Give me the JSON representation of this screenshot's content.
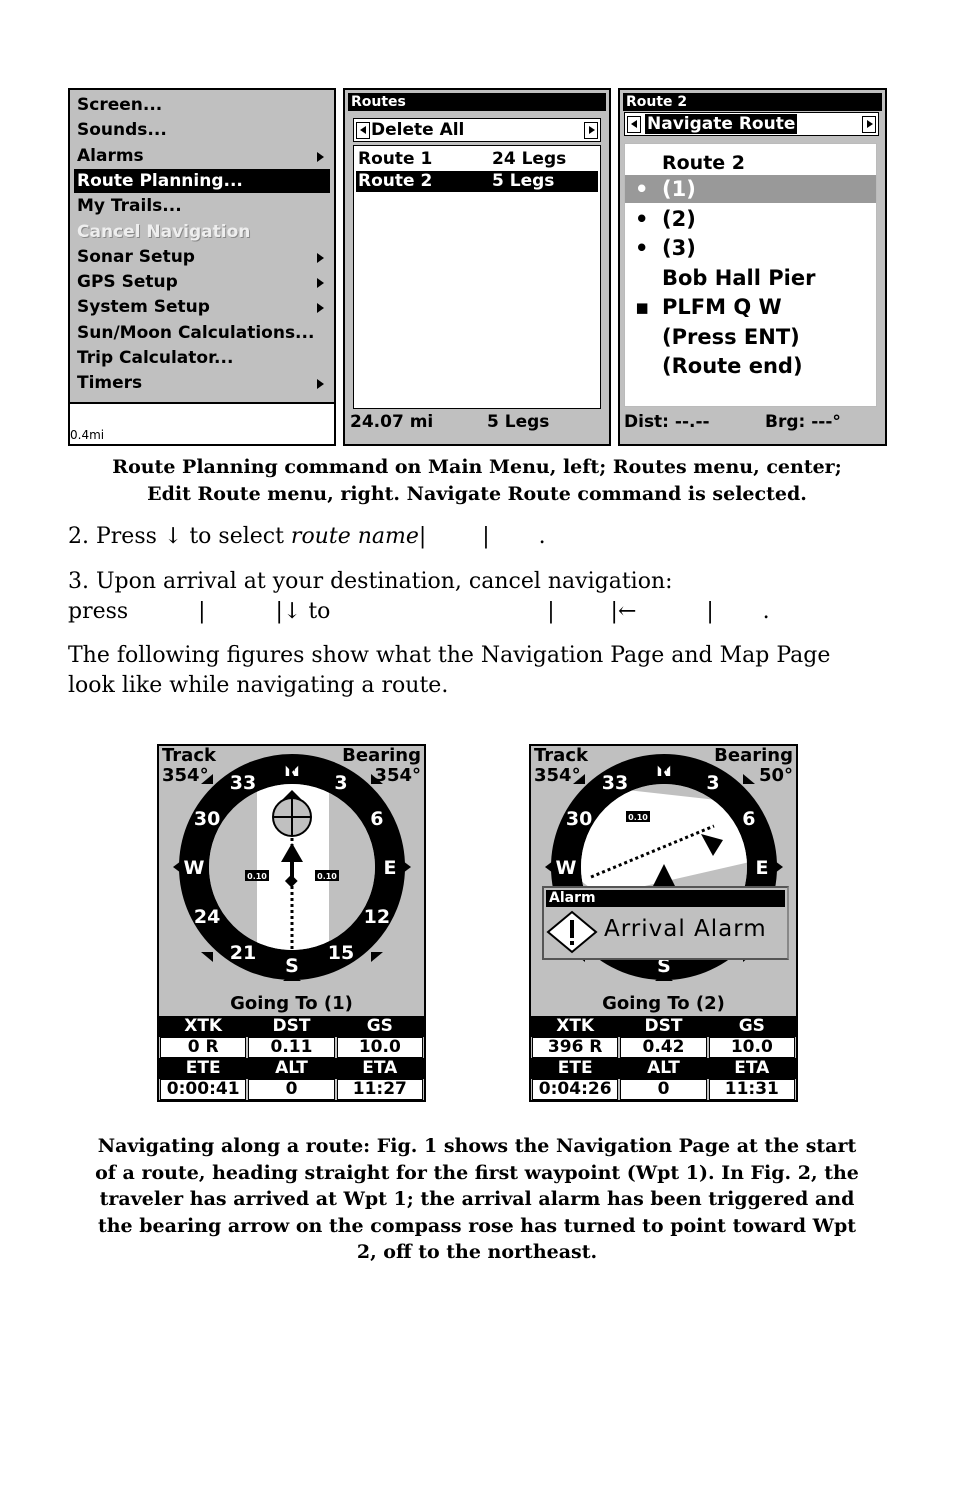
{
  "main_menu": {
    "items": [
      {
        "label": "Screen...",
        "submenu": false
      },
      {
        "label": "Sounds...",
        "submenu": false
      },
      {
        "label": "Alarms",
        "submenu": true
      },
      {
        "label": "Route Planning...",
        "submenu": false,
        "selected": true
      },
      {
        "label": "My Trails...",
        "submenu": false
      },
      {
        "label": "Cancel Navigation",
        "submenu": false,
        "disabled": true
      },
      {
        "label": "Sonar Setup",
        "submenu": true
      },
      {
        "label": "GPS Setup",
        "submenu": true
      },
      {
        "label": "System Setup",
        "submenu": true
      },
      {
        "label": "Sun/Moon Calculations...",
        "submenu": false
      },
      {
        "label": "Trip Calculator...",
        "submenu": false
      },
      {
        "label": "Timers",
        "submenu": true
      }
    ],
    "scale": "0.4mi"
  },
  "routes_menu": {
    "title": "Routes",
    "dropdown": "Delete All",
    "rows": [
      {
        "name": "Route 1",
        "legs": "24 Legs"
      },
      {
        "name": "Route 2",
        "legs": "5 Legs"
      }
    ],
    "status_dist": "24.07 mi",
    "status_legs": "5 Legs"
  },
  "edit_route": {
    "title": "Route 2",
    "dropdown": "Navigate Route",
    "heading": "Route 2",
    "items": [
      {
        "bullet": "•",
        "label": "(1)"
      },
      {
        "bullet": "•",
        "label": "(2)"
      },
      {
        "bullet": "•",
        "label": "(3)"
      },
      {
        "bullet": "",
        "label": "Bob Hall Pier"
      },
      {
        "bullet": "▪",
        "label": "PLFM Q W"
      },
      {
        "bullet": "",
        "label": "(Press ENT)"
      },
      {
        "bullet": "",
        "label": "(Route end)"
      }
    ],
    "dist": "Dist: --.--",
    "brg": "Brg: ---°"
  },
  "caption1_l1": "Route Planning command on Main Menu, left; Routes  menu, center;",
  "caption1_l2": "Edit Route menu, right. Navigate Route command is selected.",
  "step2": {
    "a": "2. Press ↓ to select ",
    "b": "route name",
    "c": "|        |       ."
  },
  "step3": {
    "l1": "3. Upon arrival at your destination, cancel navigation:",
    "l2": "press          |          |↓ to                               |        |←          |       ."
  },
  "para": {
    "l1": "The following figures show what the Navigation Page and Map Page",
    "l2": "look like while navigating a route."
  },
  "compass_labels": {
    "n": "N",
    "s": "S",
    "e": "E",
    "w": "W",
    "d3": "3",
    "d6": "6",
    "d12": "12",
    "d15": "15",
    "d21": "21",
    "d24": "24",
    "d30": "30",
    "d33": "33",
    "scale": "0.10"
  },
  "fig1": {
    "track_label": "Track",
    "track": "354°",
    "bearing_label": "Bearing",
    "bearing": "354°",
    "going": "Going To (1)",
    "headers1": [
      "XTK",
      "DST",
      "GS"
    ],
    "values1": [
      "0  R",
      "0.11",
      "10.0"
    ],
    "headers2": [
      "ETE",
      "ALT",
      "ETA"
    ],
    "values2": [
      "0:00:41",
      "0",
      "11:27"
    ]
  },
  "fig2": {
    "track_label": "Track",
    "track": "354°",
    "bearing_label": "Bearing",
    "bearing": "50°",
    "going": "Going To (2)",
    "alarm_title": "Alarm",
    "alarm_text": "Arrival Alarm",
    "headers1": [
      "XTK",
      "DST",
      "GS"
    ],
    "values1": [
      "396  R",
      "0.42",
      "10.0"
    ],
    "headers2": [
      "ETE",
      "ALT",
      "ETA"
    ],
    "values2": [
      "0:04:26",
      "0",
      "11:31"
    ]
  },
  "caption2": [
    "Navigating along a route: Fig. 1 shows the Navigation Page at the start",
    "of a route, heading straight for the first waypoint (Wpt 1). In Fig. 2, the",
    "traveler has arrived at Wpt 1; the arrival alarm has been triggered and",
    "the bearing arrow on the compass rose has turned to point toward Wpt",
    "2, off to the northeast."
  ]
}
